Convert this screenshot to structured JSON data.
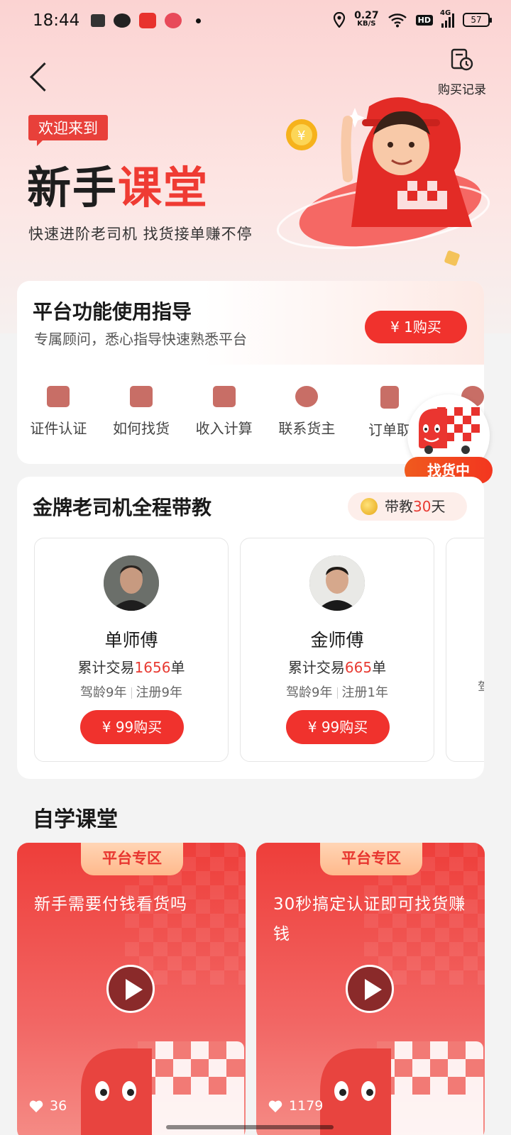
{
  "status_bar": {
    "time": "18:44",
    "speed_value": "0.27",
    "speed_unit": "KB/S",
    "hd": "HD",
    "network": "4G",
    "battery": "57"
  },
  "header": {
    "history_label": "购买记录"
  },
  "hero": {
    "welcome": "欢迎来到",
    "title_part1": "新手",
    "title_part2": "课堂",
    "subtitle": "快速进阶老司机  找货接单赚不停"
  },
  "guide": {
    "title": "平台功能使用指导",
    "subtitle": "专属顾问，悉心指导快速熟悉平台",
    "buy_label": "¥ 1购买",
    "features": [
      {
        "label": "证件认证",
        "icon": "id-card-icon"
      },
      {
        "label": "如何找货",
        "icon": "box-icon"
      },
      {
        "label": "收入计算",
        "icon": "calculator-icon"
      },
      {
        "label": "联系货主",
        "icon": "chat-icon"
      },
      {
        "label": "订单取",
        "icon": "clipboard-return-icon"
      },
      {
        "label": "",
        "icon": "money-bag-icon"
      }
    ]
  },
  "float_badge": {
    "label": "找货中"
  },
  "masters": {
    "title": "金牌老司机全程带教",
    "badge_prefix": "带教",
    "badge_days": "30",
    "badge_suffix": "天",
    "items": [
      {
        "name": "单师傅",
        "deals_prefix": "累计交易",
        "deals": "1656",
        "deals_suffix": "单",
        "driving": "驾龄9年",
        "registered": "注册9年",
        "buy_label": "¥ 99购买"
      },
      {
        "name": "金师傅",
        "deals_prefix": "累计交易",
        "deals": "665",
        "deals_suffix": "单",
        "driving": "驾龄9年",
        "registered": "注册1年",
        "buy_label": "¥ 99购买"
      },
      {
        "name": "",
        "deals_prefix": "",
        "deals": "",
        "deals_suffix": "",
        "driving": "驾",
        "registered": "",
        "buy_label": ""
      }
    ]
  },
  "study": {
    "title": "自学课堂",
    "videos": [
      {
        "zone": "平台专区",
        "title": "新手需要付钱看货吗",
        "likes": "36"
      },
      {
        "zone": "平台专区",
        "title": "30秒搞定认证即可找货赚钱",
        "likes": "1179"
      }
    ]
  },
  "colors": {
    "accent": "#f0322d",
    "highlight_text": "#e83a32",
    "hero_gradient_top": "#fbd3d2"
  }
}
